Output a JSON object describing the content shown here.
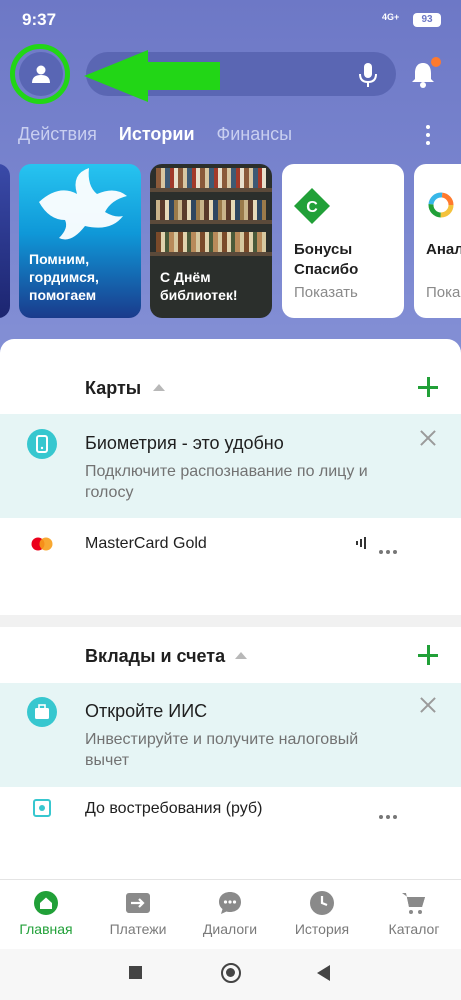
{
  "status_bar": {
    "time": "9:37",
    "network": "4G+",
    "battery": "93"
  },
  "header": {
    "tabs": [
      {
        "label": "Действия",
        "active": false
      },
      {
        "label": "Истории",
        "active": true
      },
      {
        "label": "Финансы",
        "active": false
      }
    ]
  },
  "stories": [
    {
      "text": "Помним, гордимся, помогаем"
    },
    {
      "text": "С Днём библиотек!"
    },
    {
      "title": "Бонусы Спасибо",
      "subtitle": "Показать"
    },
    {
      "title": "Анал фина",
      "subtitle": "Пока"
    }
  ],
  "cards_section": {
    "title": "Карты",
    "promo": {
      "title": "Биометрия - это удобно",
      "subtitle": "Подключите распознавание по лицу и голосу"
    },
    "items": [
      {
        "label": "MasterCard Gold"
      }
    ]
  },
  "deposits_section": {
    "title": "Вклады и счета",
    "promo": {
      "title": "Откройте ИИС",
      "subtitle": "Инвестируйте и получите налоговый вычет"
    },
    "items": [
      {
        "label": "До востребования (руб)"
      }
    ]
  },
  "bottom_nav": [
    {
      "label": "Главная",
      "icon": "home-icon",
      "active": true
    },
    {
      "label": "Платежи",
      "icon": "payments-icon",
      "active": false
    },
    {
      "label": "Диалоги",
      "icon": "chat-icon",
      "active": false
    },
    {
      "label": "История",
      "icon": "clock-icon",
      "active": false
    },
    {
      "label": "Каталог",
      "icon": "cart-icon",
      "active": false
    }
  ],
  "colors": {
    "header": "#6d78c6",
    "accent": "#21a038",
    "promo_bg": "#e6f5f5",
    "annotation": "#22d616"
  }
}
